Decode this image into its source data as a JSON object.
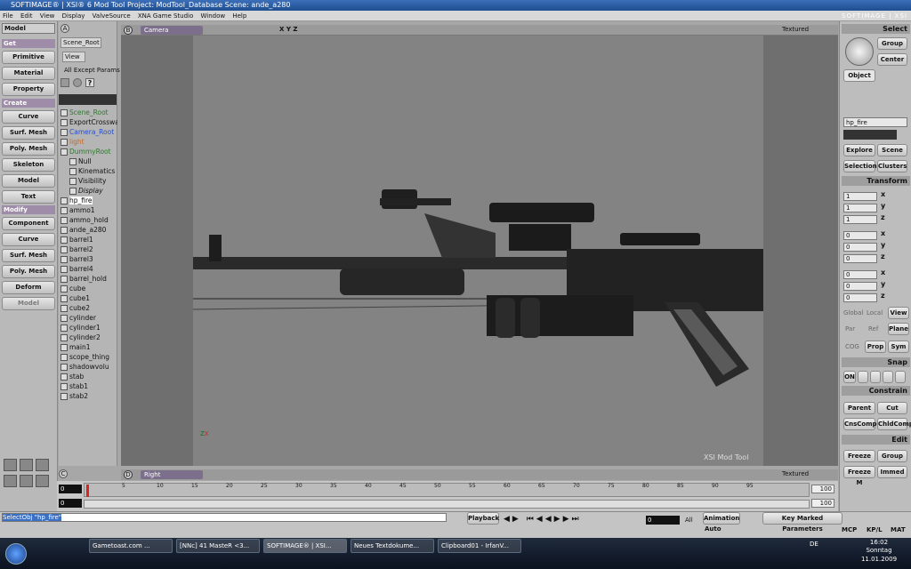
{
  "window": {
    "title": "SOFTIMAGE® | XSI® 6 Mod Tool Project: ModTool_Database    Scene: ande_a280",
    "logo": "SOFTIMAGE | XSI"
  },
  "menu": [
    "File",
    "Edit",
    "View",
    "Display",
    "ValveSource",
    "XNA Game Studio",
    "Window",
    "Help"
  ],
  "left_panel": {
    "mode": "Model",
    "get_label": "Get",
    "get_buttons": [
      "Primitive",
      "Material",
      "Property"
    ],
    "create_label": "Create",
    "create_buttons": [
      "Curve",
      "Surf. Mesh",
      "Poly. Mesh",
      "Skeleton",
      "Model",
      "Text"
    ],
    "modify_label": "Modify",
    "modify_buttons": [
      "Component",
      "Curve",
      "Surf. Mesh",
      "Poly. Mesh",
      "Deform",
      "Model"
    ]
  },
  "explorer": {
    "tab": "A",
    "scene_root_btn": "Scene_Root",
    "view_btn": "View",
    "filter": "All Except Params",
    "items": [
      {
        "label": "Scene_Root",
        "color": "#2d7a2d"
      },
      {
        "label": "ExportCrosswa",
        "color": "#111"
      },
      {
        "label": "Camera_Root",
        "color": "#2850c8"
      },
      {
        "label": "light",
        "color": "#c86a28"
      },
      {
        "label": "DummyRoot",
        "color": "#2d7a2d"
      },
      {
        "label": "Null",
        "color": "#111"
      },
      {
        "label": "Kinematics",
        "color": "#111"
      },
      {
        "label": "Visibility",
        "color": "#111"
      },
      {
        "label": "Display",
        "color": "#111"
      },
      {
        "label": "hp_fire",
        "color": "#111"
      },
      {
        "label": "ammo1",
        "color": "#111"
      },
      {
        "label": "ammo_hold",
        "color": "#111"
      },
      {
        "label": "ande_a280",
        "color": "#111"
      },
      {
        "label": "barrel1",
        "color": "#111"
      },
      {
        "label": "barrel2",
        "color": "#111"
      },
      {
        "label": "barrel3",
        "color": "#111"
      },
      {
        "label": "barrel4",
        "color": "#111"
      },
      {
        "label": "barrel_hold",
        "color": "#111"
      },
      {
        "label": "cube",
        "color": "#111"
      },
      {
        "label": "cube1",
        "color": "#111"
      },
      {
        "label": "cube2",
        "color": "#111"
      },
      {
        "label": "cylinder",
        "color": "#111"
      },
      {
        "label": "cylinder1",
        "color": "#111"
      },
      {
        "label": "cylinder2",
        "color": "#111"
      },
      {
        "label": "main1",
        "color": "#111"
      },
      {
        "label": "scope_thing",
        "color": "#111"
      },
      {
        "label": "shadowvolu",
        "color": "#111"
      },
      {
        "label": "stab",
        "color": "#111"
      },
      {
        "label": "stab1",
        "color": "#111"
      },
      {
        "label": "stab2",
        "color": "#111"
      }
    ]
  },
  "viewport_top": {
    "tab": "B",
    "camera": "Camera",
    "axes": "X Y Z",
    "mode": "Textured",
    "watermark": "XSI Mod Tool"
  },
  "viewport_bottom": {
    "tab": "D",
    "camera": "Right",
    "mode": "Textured"
  },
  "timeline": {
    "start": "0",
    "start2": "0",
    "end": "100",
    "end2": "100",
    "ticks": [
      "5",
      "10",
      "15",
      "20",
      "25",
      "30",
      "35",
      "40",
      "45",
      "50",
      "55",
      "60",
      "65",
      "70",
      "75",
      "80",
      "85",
      "90",
      "95"
    ]
  },
  "command": {
    "text": "SelectObj \"hp_fire\"",
    "playback": "Playback",
    "frame": "0",
    "all": "All",
    "animation": "Animation",
    "auto": "Auto",
    "key_marked": "Key Marked Parameters",
    "tabs": [
      "MCP",
      "KP/L",
      "MAT"
    ]
  },
  "right_panel": {
    "select_label": "Select",
    "group": "Group",
    "center": "Center",
    "object": "Object",
    "selected_name": "hp_fire",
    "explore": "Explore",
    "scene": "Scene",
    "selection": "Selection",
    "clusters": "Clusters",
    "transform_label": "Transform",
    "scale": [
      "1",
      "1",
      "1"
    ],
    "rotate": [
      "0",
      "0",
      "0"
    ],
    "translate": [
      "0",
      "0",
      "0"
    ],
    "axes": [
      "x",
      "y",
      "z"
    ],
    "ref_modes": [
      "Global",
      "Local",
      "View"
    ],
    "ref_modes2": [
      "Par",
      "Ref",
      "Plane"
    ],
    "cog": "COG",
    "prop": "Prop",
    "sym": "Sym",
    "snap_label": "Snap",
    "snap_on": "ON",
    "constrain_label": "Constrain",
    "parent": "Parent",
    "cut": "Cut",
    "cnscomp": "CnsComp",
    "chldcomp": "ChldComp",
    "edit_label": "Edit",
    "freeze": "Freeze",
    "group2": "Group",
    "freeze_m": "Freeze M",
    "immed": "Immed"
  },
  "taskbar": {
    "tasks": [
      "Gametoast.com ...",
      "[NNc] 41 MasteR <3...",
      "SOFTIMAGE® | XSI...",
      "Neues Textdokume...",
      "Clipboard01 - IrfanV..."
    ],
    "lang": "DE",
    "time": "16:02",
    "day": "Sonntag",
    "date": "11.01.2009"
  },
  "colors": {
    "accent": "#7c6f8c",
    "title": "#1e4e8f"
  }
}
